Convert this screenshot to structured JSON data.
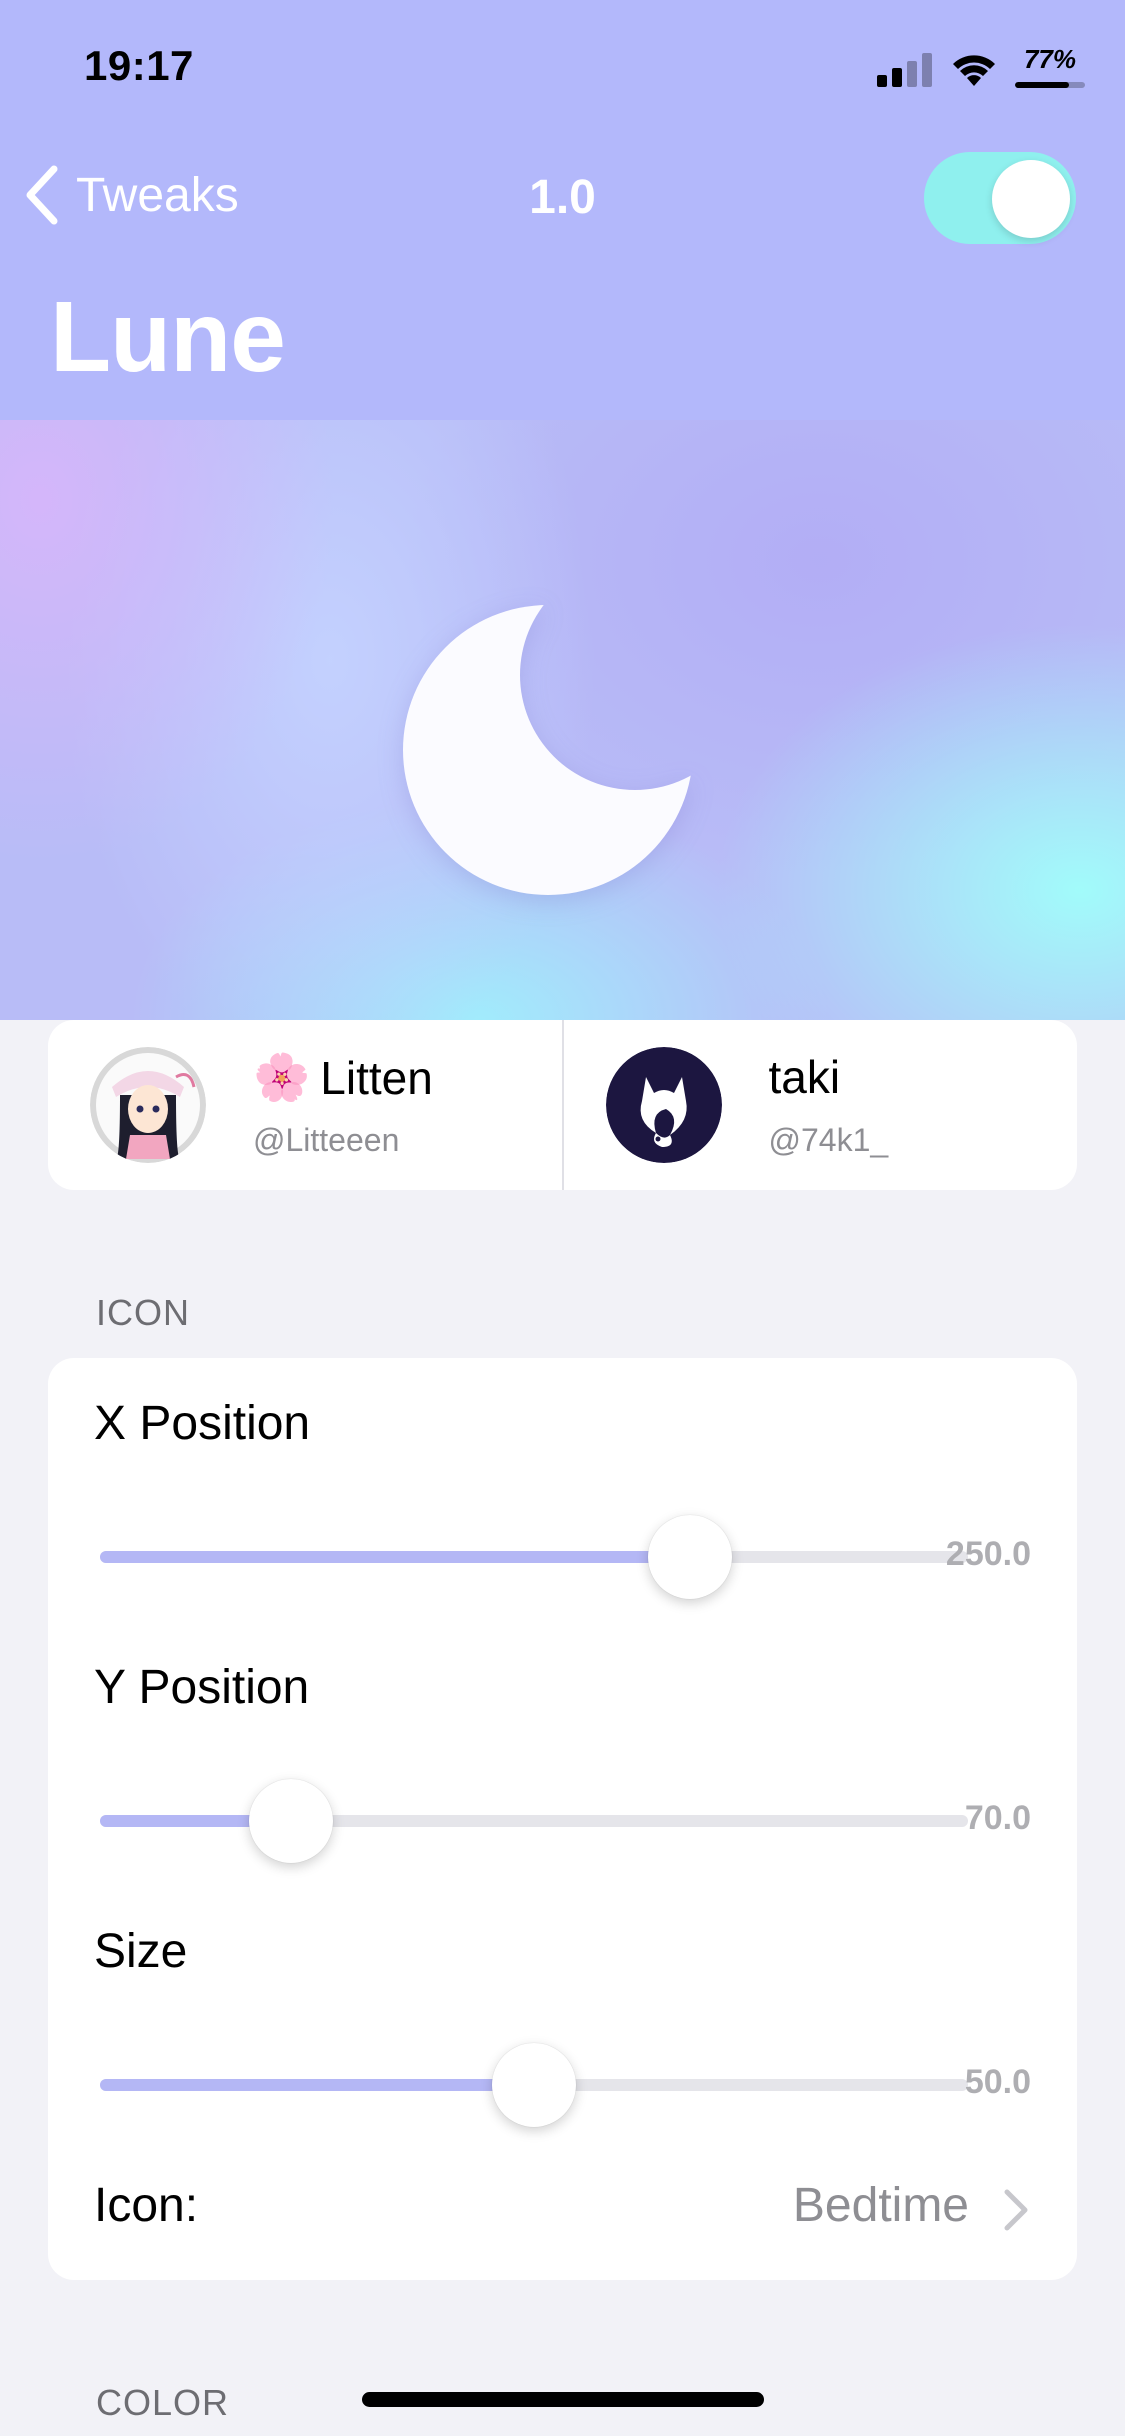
{
  "status_bar": {
    "time": "19:17",
    "battery_percent": "77%",
    "battery_level": 0.77
  },
  "nav": {
    "back_label": "Tweaks",
    "version": "1.0",
    "enabled": true
  },
  "page": {
    "title": "Lune"
  },
  "authors": [
    {
      "emoji": "🌸",
      "name": "Litten",
      "handle": "@Litteeen"
    },
    {
      "emoji": "",
      "name": "taki",
      "handle": "@74k1_"
    }
  ],
  "sections": {
    "icon": "ICON",
    "color": "COLOR"
  },
  "sliders": [
    {
      "label": "X Position",
      "value_text": "250.0",
      "fraction": 0.68
    },
    {
      "label": "Y Position",
      "value_text": "70.0",
      "fraction": 0.22
    },
    {
      "label": "Size",
      "value_text": "50.0",
      "fraction": 0.5
    }
  ],
  "icon_row": {
    "label": "Icon:",
    "value": "Bedtime"
  },
  "colors": {
    "header": "#b3b8fb",
    "toggle_on": "#8ff0ee",
    "slider_fill": "#b4b7f5",
    "background": "#f2f2f7"
  }
}
